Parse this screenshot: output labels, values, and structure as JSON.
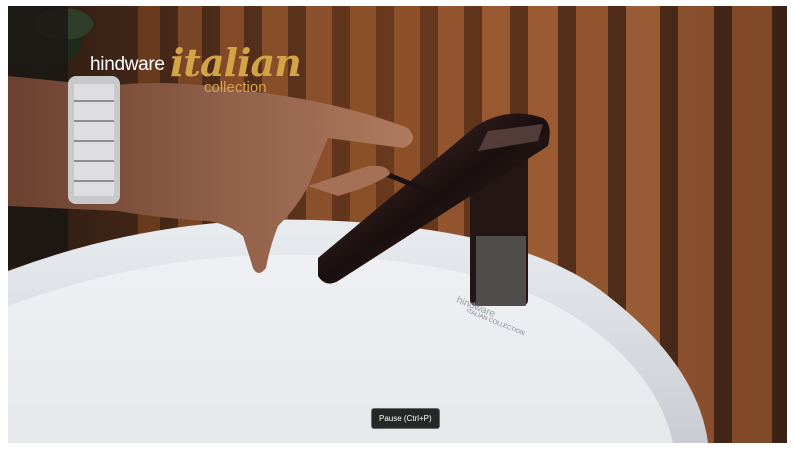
{
  "video": {
    "brand_logo": {
      "brand": "hindware",
      "series": "italian",
      "subtitle": "collection"
    },
    "basin_print": {
      "brand": "hindware",
      "collection": "ITALIAN COLLECTION"
    },
    "tooltip": {
      "pause_label": "Pause (Ctrl+P)"
    }
  }
}
